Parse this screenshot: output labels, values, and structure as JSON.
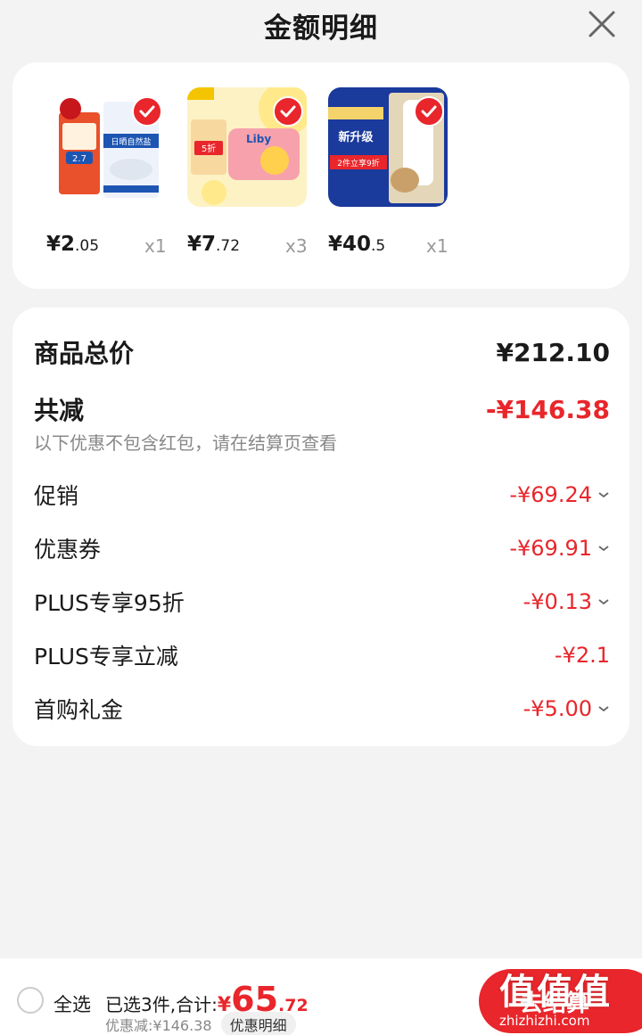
{
  "header": {
    "title": "金额明细"
  },
  "products": [
    {
      "price_int": "¥2",
      "price_dec": ".05",
      "qty": "x1",
      "thumb_badge": "2.7",
      "thumb_text": "日晒自然盐"
    },
    {
      "price_int": "¥7",
      "price_dec": ".72",
      "qty": "x3",
      "thumb_badge": "5折",
      "thumb_text": "Liby"
    },
    {
      "price_int": "¥40",
      "price_dec": ".5",
      "qty": "x1",
      "thumb_badge": "2件立享9折",
      "thumb_text": "新升级"
    }
  ],
  "summary": {
    "total_label": "商品总价",
    "total_value": "¥212.10",
    "reduce_label": "共减",
    "reduce_value": "-¥146.38",
    "note": "以下优惠不包含红包，请在结算页查看",
    "items": [
      {
        "label": "促销",
        "value": "-¥69.24",
        "expandable": true
      },
      {
        "label": "优惠券",
        "value": "-¥69.91",
        "expandable": true
      },
      {
        "label": "PLUS专享95折",
        "value": "-¥0.13",
        "expandable": true
      },
      {
        "label": "PLUS专享立减",
        "value": "-¥2.1",
        "expandable": false
      },
      {
        "label": "首购礼金",
        "value": "-¥5.00",
        "expandable": true
      }
    ]
  },
  "footer": {
    "select_all": "全选",
    "selected_text": "已选3件,合计:",
    "total_currency": "¥",
    "total_int": "65",
    "total_dec": ".72",
    "discount_text": "优惠减:¥146.38",
    "detail_button": "优惠明细",
    "checkout": "去结算"
  },
  "watermark": {
    "big": "值值值",
    "small": "zhizhizhi.com"
  },
  "colors": {
    "accent": "#e8262b",
    "background": "#f3f3f3"
  }
}
